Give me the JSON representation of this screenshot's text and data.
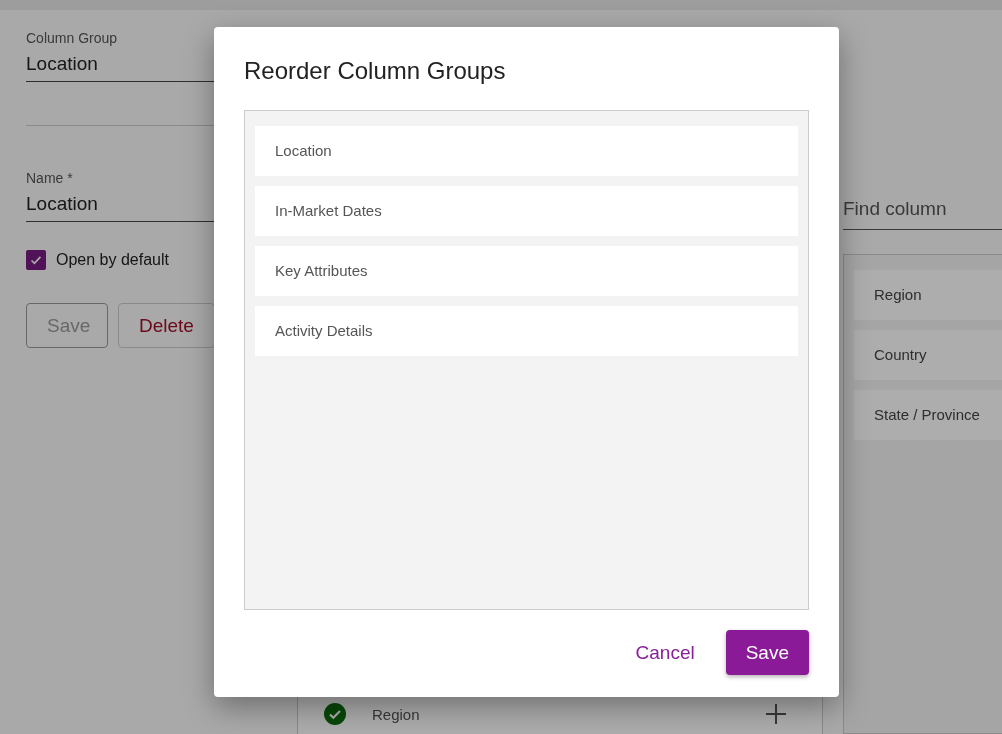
{
  "editor": {
    "column_group": {
      "label": "Column Group",
      "value": "Location"
    },
    "name_field": {
      "label": "Name *",
      "value": "Location"
    },
    "open_by_default": {
      "label": "Open by default",
      "checked": true
    },
    "buttons": [
      {
        "label": "Save",
        "kind": "outlined",
        "disabled": true
      },
      {
        "label": "Delete",
        "kind": "danger",
        "disabled": false
      }
    ]
  },
  "selected_columns": {
    "rows": [
      {
        "label": "Region",
        "included": true
      }
    ]
  },
  "column_picker": {
    "search": {
      "placeholder": "Find column"
    },
    "items": [
      {
        "label": "Region"
      },
      {
        "label": "Country"
      },
      {
        "label": "State / Province"
      }
    ]
  },
  "dialog": {
    "title": "Reorder Column Groups",
    "items": [
      {
        "label": "Location"
      },
      {
        "label": "In-Market Dates"
      },
      {
        "label": "Key Attributes"
      },
      {
        "label": "Activity Details"
      }
    ],
    "buttons": [
      {
        "label": "Cancel",
        "kind": "text"
      },
      {
        "label": "Save",
        "kind": "primary"
      }
    ]
  }
}
